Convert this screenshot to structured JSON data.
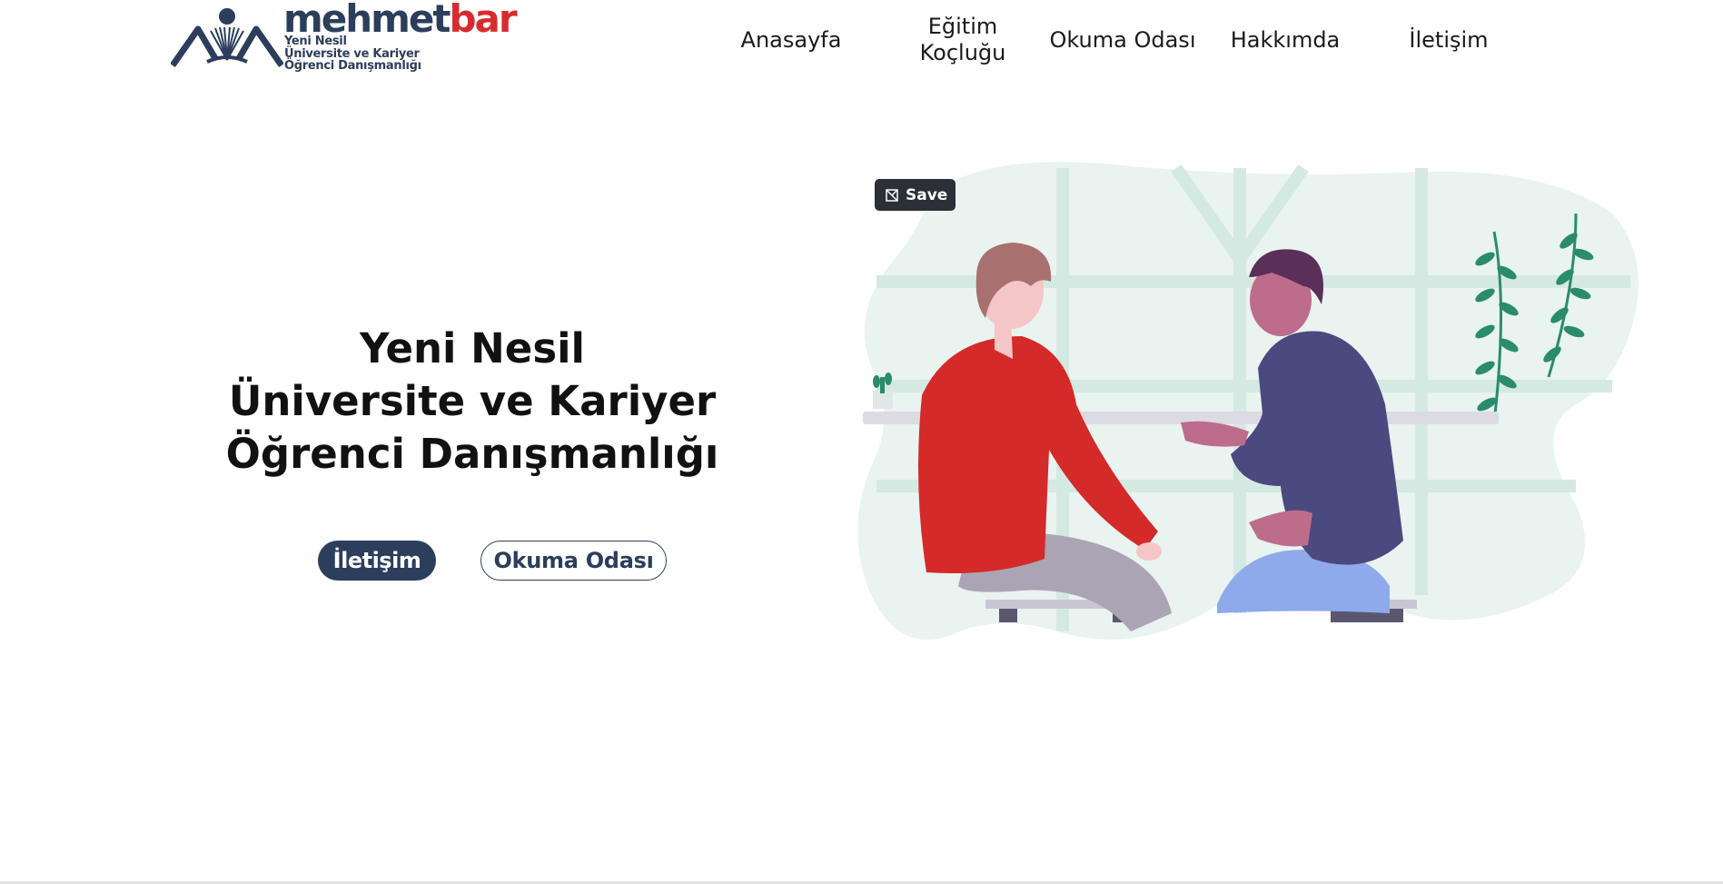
{
  "header": {
    "logo": {
      "word_part1": "mehmet",
      "word_part2": "bar",
      "tagline": [
        "Yeni Nesil",
        "Üniversite ve Kariyer",
        "Öğrenci Danışmanlığı"
      ]
    },
    "nav": [
      {
        "label": "Anasayfa"
      },
      {
        "label": "Eğitim Koçluğu"
      },
      {
        "label": "Okuma Odası"
      },
      {
        "label": "Hakkımda"
      },
      {
        "label": "İletişim"
      }
    ]
  },
  "hero": {
    "title_lines": [
      "Yeni Nesil",
      "Üniversite ve Kariyer",
      "Öğrenci Danışmanlığı"
    ],
    "primary_button": "İletişim",
    "secondary_button": "Okuma Odası"
  },
  "save_overlay": {
    "label": "Save",
    "icon": "pinterest-save-icon"
  },
  "colors": {
    "brand_dark": "#2c3e5c",
    "brand_red": "#d92b2e",
    "illustration_bg": "#e9f3f0",
    "shirt_red": "#d42a2a",
    "shirt_purple": "#4a4a80"
  }
}
